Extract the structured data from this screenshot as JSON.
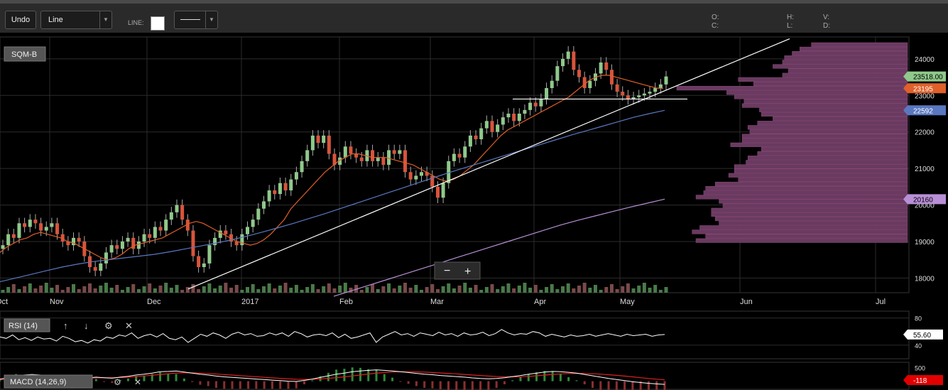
{
  "toolbar": {
    "undo_label": "Undo",
    "chart_type": "Line",
    "line_label": "LINE:",
    "line_color": "#ffffff",
    "ohlc_labels": [
      "O:",
      "H:",
      "V:",
      "C:",
      "L:",
      "D:"
    ]
  },
  "colors": {
    "background": "#000000",
    "up_candle": "#8fc98b",
    "down_candle": "#d8543c",
    "ma_short": "#e0602a",
    "ma_mid": "#5a78c0",
    "ma_long": "#b88fd6",
    "volume_profile": "#6a3a60",
    "trendline": "#ffffff"
  },
  "chart_data": [
    {
      "type": "candlestick",
      "title": "SQM-B",
      "x_tick_labels": [
        "Oct",
        "Nov",
        "Dec",
        "2017",
        "Feb",
        "Mar",
        "Apr",
        "May",
        "Jun",
        "Jul"
      ],
      "y_ticks": [
        18000,
        19000,
        20000,
        21000,
        22000,
        23000,
        24000
      ],
      "ylim": [
        17600,
        24600
      ],
      "grid": true,
      "price_badges": [
        {
          "label": "23518.00",
          "value": 23518,
          "color": "#8fc98b",
          "text_color": "#000000"
        },
        {
          "label": "23195",
          "value": 23195,
          "color": "#e0602a",
          "text_color": "#ffffff"
        },
        {
          "label": "22592",
          "value": 22592,
          "color": "#5a78c0",
          "text_color": "#ffffff"
        },
        {
          "label": "20160",
          "value": 20160,
          "color": "#b88fd6",
          "text_color": "#000000"
        }
      ],
      "candle_closes": [
        18900,
        19200,
        19100,
        19500,
        19400,
        19600,
        19500,
        19300,
        19400,
        19500,
        19200,
        19000,
        18900,
        19100,
        19000,
        18600,
        18300,
        18200,
        18400,
        18700,
        18900,
        18800,
        19000,
        19100,
        18800,
        19000,
        19200,
        19100,
        19400,
        19300,
        19600,
        19800,
        20000,
        19600,
        19300,
        18600,
        18300,
        18400,
        18900,
        19100,
        19300,
        19200,
        19000,
        18900,
        19200,
        19400,
        19600,
        19900,
        20100,
        20400,
        20300,
        20600,
        20400,
        20700,
        20900,
        21200,
        21500,
        21900,
        21700,
        21900,
        21400,
        21100,
        21300,
        21600,
        21400,
        21300,
        21200,
        21500,
        21200,
        21300,
        21100,
        21500,
        21400,
        21500,
        20900,
        20700,
        20800,
        20900,
        20800,
        20500,
        20200,
        20600,
        21200,
        21400,
        21300,
        21600,
        21900,
        21800,
        22100,
        22300,
        22000,
        22200,
        22400,
        22500,
        22300,
        22500,
        22600,
        22800,
        22700,
        22900,
        23200,
        23400,
        23800,
        24000,
        24200,
        23700,
        23500,
        23200,
        23400,
        23600,
        23900,
        23700,
        23300,
        23100,
        23000,
        22900,
        22950,
        23000,
        23050,
        23100,
        23200,
        23300,
        23518
      ],
      "ma_short_values": [
        18700,
        18850,
        18950,
        19050,
        19100,
        19200,
        19250,
        19200,
        19150,
        19100,
        19000,
        18950,
        18850,
        18750,
        18650,
        18550,
        18500,
        18550,
        18650,
        18800,
        18900,
        18950,
        19000,
        19050,
        19100,
        19200,
        19300,
        19400,
        19500,
        19550,
        19500,
        19400,
        19300,
        19200,
        19100,
        19000,
        18950,
        18900,
        18950,
        19050,
        19200,
        19400,
        19600,
        19900,
        20100,
        20300,
        20500,
        20700,
        20900,
        21050,
        21200,
        21300,
        21400,
        21400,
        21350,
        21300,
        21300,
        21300,
        21250,
        21200,
        21150,
        21100,
        21000,
        20900,
        20800,
        20700,
        20650,
        20700,
        20800,
        20950,
        21100,
        21300,
        21500,
        21700,
        21900,
        22050,
        22150,
        22250,
        22350,
        22450,
        22550,
        22650,
        22750,
        22850,
        22950,
        23100,
        23250,
        23400,
        23500,
        23550,
        23550,
        23500,
        23450,
        23400,
        23350,
        23300,
        23250,
        23200,
        23195
      ],
      "ma_mid_values": [
        17900,
        18000,
        18100,
        18200,
        18300,
        18380,
        18450,
        18500,
        18550,
        18600,
        18650,
        18720,
        18800,
        18880,
        18960,
        19050,
        19150,
        19260,
        19380,
        19500,
        19630,
        19760,
        19900,
        20040,
        20180,
        20320,
        20460,
        20600,
        20740,
        20880,
        21010,
        21140,
        21270,
        21400,
        21530,
        21660,
        21790,
        21920,
        22040,
        22160,
        22280,
        22400,
        22500,
        22592
      ],
      "ma_long_values": [
        17500,
        17650,
        17800,
        17950,
        18100,
        18250,
        18400,
        18550,
        18700,
        18850,
        19000,
        19150,
        19300,
        19450,
        19580,
        19700,
        19820,
        19940,
        20050,
        20160
      ],
      "volume_profile_values": [
        500,
        560,
        600,
        640,
        650,
        700,
        620,
        650,
        880,
        800,
        1200,
        940,
        900,
        850,
        860,
        770,
        760,
        700,
        780,
        830,
        820,
        860,
        860,
        920,
        760,
        780,
        830,
        840,
        900,
        900,
        930,
        880,
        1000,
        1050,
        1060,
        1100,
        980,
        960,
        1020,
        1020,
        1000,
        980,
        1080,
        1120,
        1050,
        1100
      ],
      "rsi": {
        "label": "RSI (14)",
        "value_label": "55.60",
        "y_ticks": [
          40,
          80
        ],
        "ylim": [
          20,
          90
        ],
        "values": [
          52,
          50,
          55,
          48,
          51,
          47,
          52,
          49,
          50,
          46,
          53,
          50,
          45,
          47,
          43,
          48,
          46,
          52,
          50,
          55,
          53,
          58,
          50,
          54,
          56,
          52,
          57,
          50,
          48,
          52,
          44,
          50,
          56,
          53,
          58,
          55,
          50,
          56,
          59,
          55,
          57,
          53,
          54,
          58,
          55,
          58,
          53,
          60,
          57,
          52,
          55,
          56,
          54,
          58,
          51,
          56,
          50,
          52,
          55,
          58,
          44,
          52,
          56,
          60,
          55,
          57,
          53,
          58,
          56,
          54,
          59,
          55,
          57,
          53,
          58,
          55,
          56,
          59,
          54,
          57,
          63,
          58,
          55,
          57,
          56,
          60,
          58,
          53,
          56,
          54,
          52,
          55,
          53,
          54,
          56,
          53,
          55,
          57,
          55,
          53,
          56,
          54,
          55,
          56,
          53,
          55,
          55.6
        ]
      },
      "macd": {
        "label": "MACD (14,26,9)",
        "value_label": "-118",
        "y_ticks": [
          500
        ],
        "ylim": [
          -300,
          700
        ],
        "macd_line": [
          80,
          120,
          200,
          230,
          250,
          230,
          190,
          150,
          110,
          60,
          80,
          120,
          150,
          130,
          110,
          150,
          180,
          230,
          260,
          300,
          350,
          360,
          380,
          340,
          300,
          260,
          230,
          190,
          160,
          140,
          120,
          100,
          80,
          60,
          40,
          20,
          0,
          -10,
          30,
          80,
          140,
          200,
          260,
          300,
          350,
          380,
          400,
          420,
          400,
          380,
          350,
          320,
          290,
          260,
          240,
          210,
          190,
          170,
          150,
          120,
          100,
          90,
          100,
          130,
          170,
          210,
          260,
          300,
          340,
          360,
          350,
          330,
          300,
          250,
          200,
          150,
          100,
          60,
          20,
          -20,
          -50,
          -80,
          -100,
          -118
        ],
        "signal_line": [
          60,
          80,
          120,
          160,
          190,
          210,
          205,
          190,
          170,
          140,
          120,
          120,
          125,
          130,
          130,
          135,
          150,
          170,
          195,
          220,
          250,
          275,
          300,
          310,
          310,
          300,
          285,
          265,
          245,
          225,
          205,
          185,
          165,
          145,
          125,
          105,
          85,
          70,
          65,
          70,
          85,
          105,
          130,
          160,
          195,
          230,
          265,
          295,
          320,
          340,
          350,
          350,
          345,
          335,
          320,
          305,
          290,
          270,
          250,
          230,
          210,
          190,
          175,
          165,
          160,
          165,
          180,
          200,
          225,
          250,
          270,
          285,
          290,
          285,
          275,
          260,
          240,
          215,
          190,
          160,
          130,
          100,
          75,
          50
        ]
      }
    }
  ]
}
